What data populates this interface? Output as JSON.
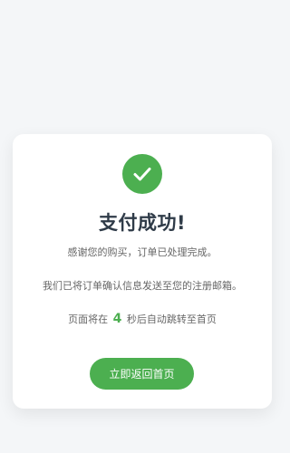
{
  "page": {
    "title": "支付成功!",
    "message_line1": "感谢您的购买，订单已处理完成。",
    "message_line2": "我们已将订单确认信息发送至您的注册邮箱。",
    "countdown_prefix": "页面将在",
    "countdown_value": "4",
    "countdown_suffix": "秒后自动跳转至首页",
    "return_button_label": "立即返回首页",
    "success_icon": "check-icon",
    "accent_color": "#4caf50"
  }
}
